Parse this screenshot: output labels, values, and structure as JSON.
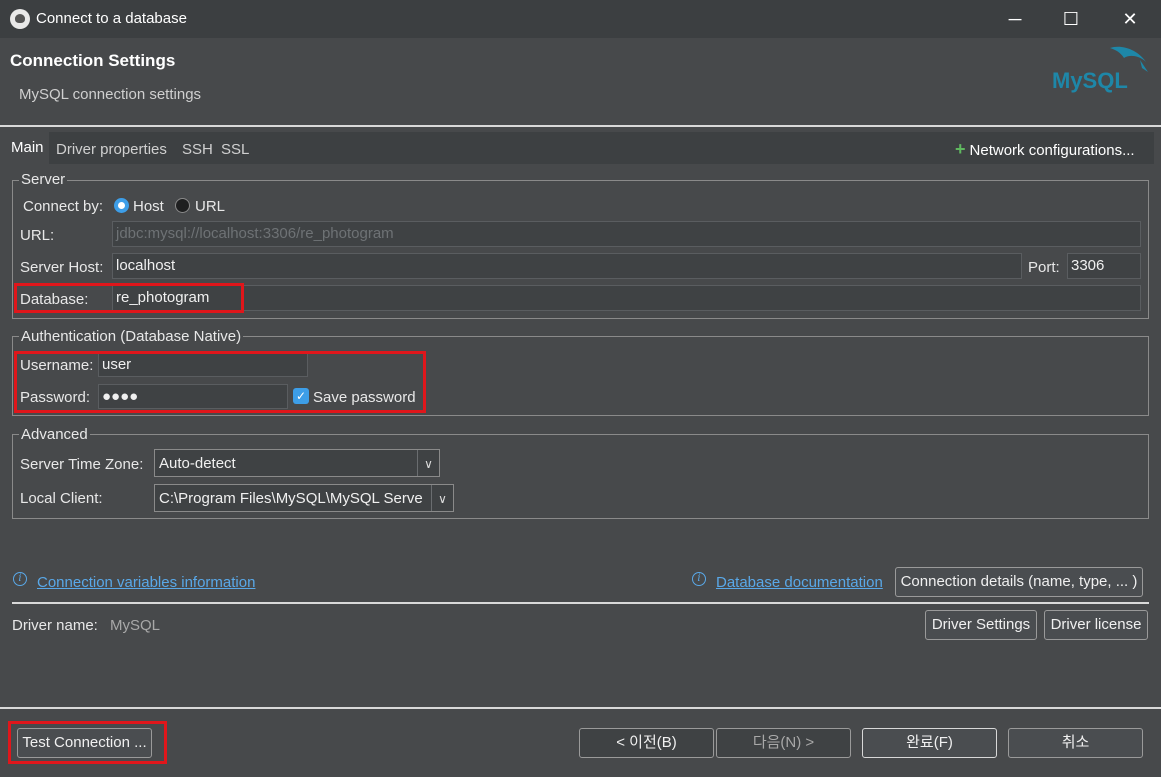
{
  "window": {
    "title": "Connect to a database",
    "minimize": "─",
    "maximize": "☐",
    "close": "✕"
  },
  "header": {
    "title": "Connection Settings",
    "subtitle": "MySQL connection settings",
    "logo_text": "MySQL"
  },
  "tabs": [
    {
      "label": "Main",
      "active": true
    },
    {
      "label": "Driver properties",
      "active": false
    },
    {
      "label": "SSH",
      "active": false
    },
    {
      "label": "SSL",
      "active": false
    }
  ],
  "network_configs": {
    "icon": "plus-icon",
    "label": "Network configurations..."
  },
  "server": {
    "legend": "Server",
    "connect_by_label": "Connect by:",
    "options": [
      {
        "label": "Host",
        "selected": true
      },
      {
        "label": "URL",
        "selected": false
      }
    ],
    "url_label": "URL:",
    "url_value": "jdbc:mysql://localhost:3306/re_photogram",
    "host_label": "Server Host:",
    "host_value": "localhost",
    "port_label": "Port:",
    "port_value": "3306",
    "database_label": "Database:",
    "database_value": "re_photogram"
  },
  "auth": {
    "legend": "Authentication (Database Native)",
    "username_label": "Username:",
    "username_value": "user",
    "password_label": "Password:",
    "password_value": "●●●●",
    "save_password_label": "Save password",
    "save_password_checked": true
  },
  "advanced": {
    "legend": "Advanced",
    "timezone_label": "Server Time Zone:",
    "timezone_value": "Auto-detect",
    "client_label": "Local Client:",
    "client_value": "C:\\Program Files\\MySQL\\MySQL Serve"
  },
  "links": {
    "conn_vars": "Connection variables information",
    "db_docs": "Database documentation",
    "conn_details_button": "Connection details (name, type, ... )"
  },
  "driver": {
    "label": "Driver name:",
    "value": "MySQL",
    "settings_button": "Driver Settings",
    "license_button": "Driver license"
  },
  "footer": {
    "test_button": "Test Connection ...",
    "prev_button": "< 이전(B)",
    "next_button": "다음(N) >",
    "finish_button": "완료(F)",
    "cancel_button": "취소"
  },
  "colors": {
    "accent": "#3d9ee8",
    "highlight_box": "#e0161b",
    "link": "#59a8e8"
  }
}
